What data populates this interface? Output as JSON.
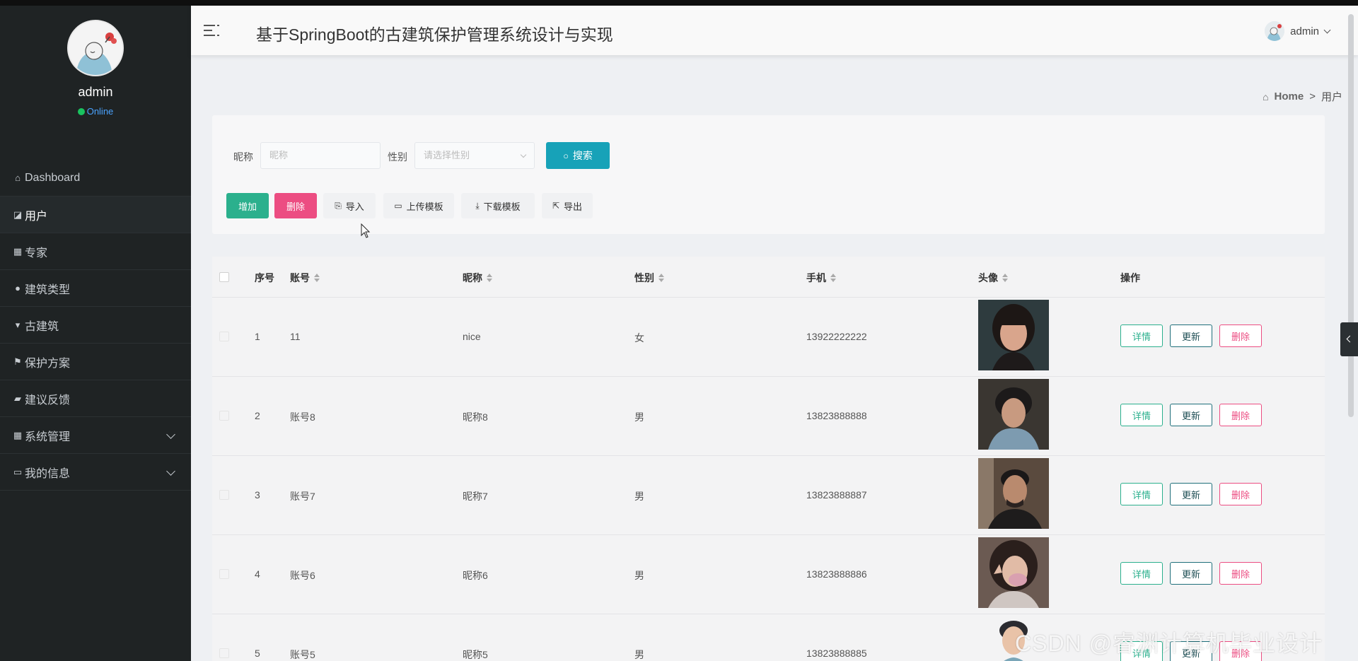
{
  "sidebar": {
    "username": "admin",
    "status": "Online",
    "items": [
      {
        "label": "Dashboard",
        "icon": "home-icon"
      },
      {
        "label": "用户",
        "icon": "chart-icon"
      },
      {
        "label": "专家",
        "icon": "grid-icon"
      },
      {
        "label": "建筑类型",
        "icon": "pin-icon"
      },
      {
        "label": "古建筑",
        "icon": "marker-icon"
      },
      {
        "label": "保护方案",
        "icon": "flag-icon"
      },
      {
        "label": "建议反馈",
        "icon": "thumb-icon"
      },
      {
        "label": "系统管理",
        "icon": "grid-icon"
      },
      {
        "label": "我的信息",
        "icon": "card-icon"
      }
    ]
  },
  "header": {
    "title": "基于SpringBoot的古建筑保护管理系统设计与实现",
    "user": "admin"
  },
  "breadcrumb": {
    "home": "Home",
    "sep": ">",
    "current": "用户"
  },
  "search": {
    "nickname_label": "昵称",
    "nickname_placeholder": "昵称",
    "gender_label": "性别",
    "gender_placeholder": "请选择性别",
    "search_button": "搜索"
  },
  "actions": {
    "add": "增加",
    "delete": "删除",
    "import": "导入",
    "upload_template": "上传模板",
    "download_template": "下载模板",
    "export": "导出"
  },
  "table": {
    "columns": {
      "index": "序号",
      "account": "账号",
      "nickname": "昵称",
      "gender": "性别",
      "phone": "手机",
      "avatar": "头像",
      "operation": "操作"
    },
    "rows": [
      {
        "index": "1",
        "account": "11",
        "nickname": "nice",
        "gender": "女",
        "phone": "13922222222"
      },
      {
        "index": "2",
        "account": "账号8",
        "nickname": "昵称8",
        "gender": "男",
        "phone": "13823888888"
      },
      {
        "index": "3",
        "account": "账号7",
        "nickname": "昵称7",
        "gender": "男",
        "phone": "13823888887"
      },
      {
        "index": "4",
        "account": "账号6",
        "nickname": "昵称6",
        "gender": "男",
        "phone": "13823888886"
      },
      {
        "index": "5",
        "account": "账号5",
        "nickname": "昵称5",
        "gender": "男",
        "phone": "13823888885"
      }
    ],
    "op_detail": "详情",
    "op_update": "更新",
    "op_delete": "删除"
  },
  "watermark": "CSDN @睿渊计算机毕业设计"
}
